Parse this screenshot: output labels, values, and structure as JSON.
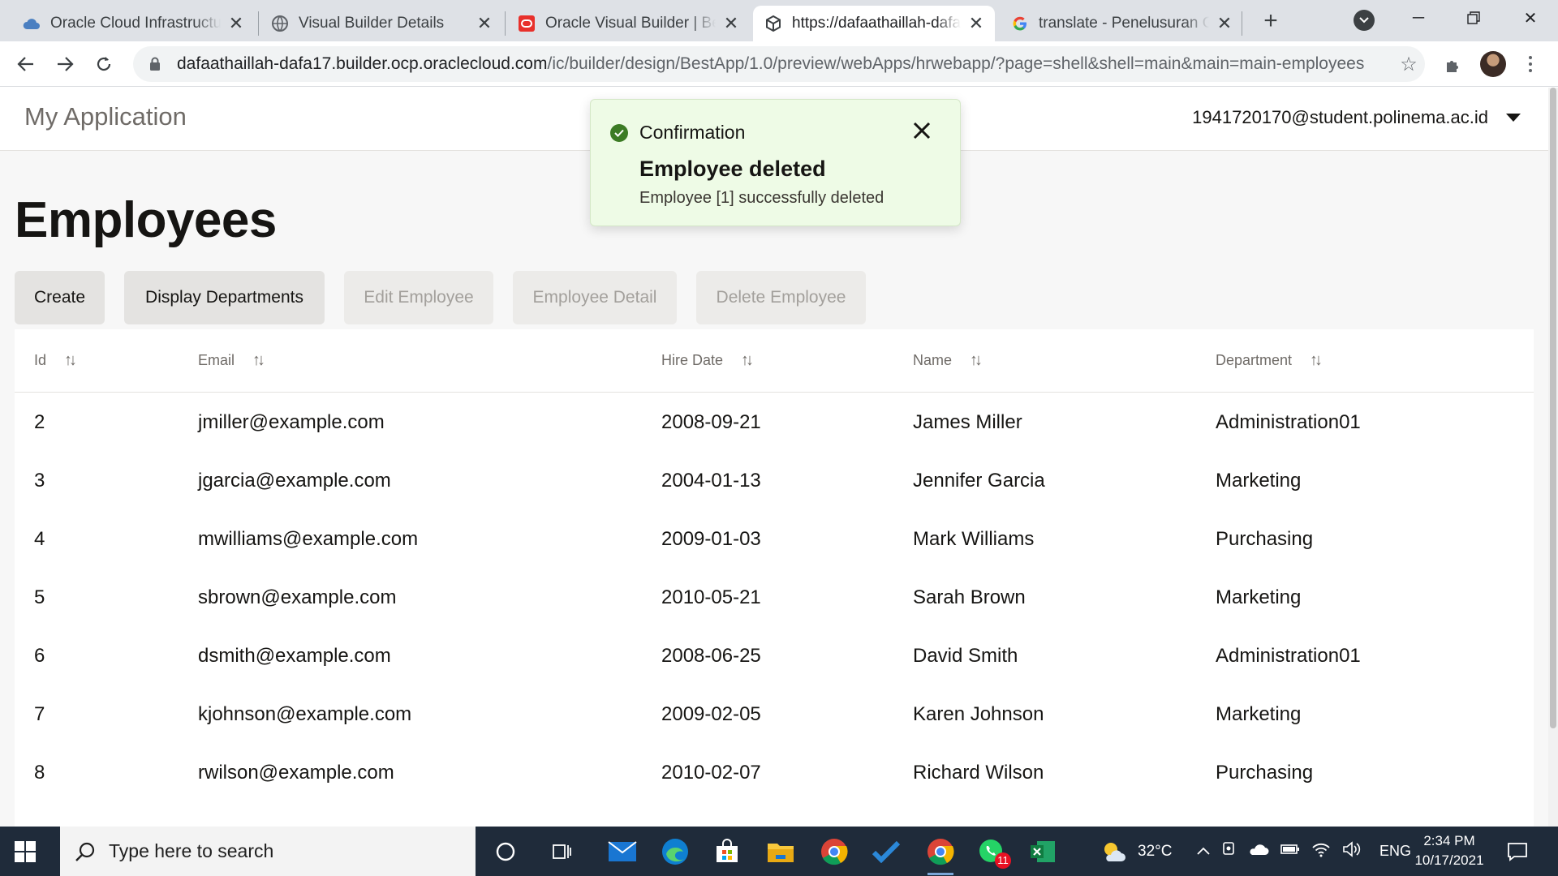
{
  "browser": {
    "tabs": [
      {
        "label": "Oracle Cloud Infrastructure",
        "icon": "cloud-icon"
      },
      {
        "label": "Visual Builder Details",
        "icon": "globe-icon"
      },
      {
        "label": "Oracle Visual Builder | Best",
        "icon": "oracle-icon"
      },
      {
        "label": "https://dafaathaillah-dafa17",
        "icon": "cube-icon"
      },
      {
        "label": "translate - Penelusuran Google",
        "icon": "google-icon"
      }
    ],
    "active_tab_index": 3,
    "url_host": "dafaathaillah-dafa17.builder.ocp.oraclecloud.com",
    "url_path": "/ic/builder/design/BestApp/1.0/preview/webApps/hrwebapp/?page=shell&shell=main&main=main-employees"
  },
  "app": {
    "title": "My Application",
    "user": "1941720170@student.polinema.ac.id",
    "page_title": "Employees",
    "buttons": [
      {
        "label": "Create",
        "enabled": true
      },
      {
        "label": "Display Departments",
        "enabled": true
      },
      {
        "label": "Edit Employee",
        "enabled": false
      },
      {
        "label": "Employee Detail",
        "enabled": false
      },
      {
        "label": "Delete Employee",
        "enabled": false
      }
    ],
    "table": {
      "columns": [
        "Id",
        "Email",
        "Hire Date",
        "Name",
        "Department"
      ],
      "rows": [
        [
          "2",
          "jmiller@example.com",
          "2008-09-21",
          "James Miller",
          "Administration01"
        ],
        [
          "3",
          "jgarcia@example.com",
          "2004-01-13",
          "Jennifer Garcia",
          "Marketing"
        ],
        [
          "4",
          "mwilliams@example.com",
          "2009-01-03",
          "Mark Williams",
          "Purchasing"
        ],
        [
          "5",
          "sbrown@example.com",
          "2010-05-21",
          "Sarah Brown",
          "Marketing"
        ],
        [
          "6",
          "dsmith@example.com",
          "2008-06-25",
          "David Smith",
          "Administration01"
        ],
        [
          "7",
          "kjohnson@example.com",
          "2009-02-05",
          "Karen Johnson",
          "Marketing"
        ],
        [
          "8",
          "rwilson@example.com",
          "2010-02-07",
          "Richard Wilson",
          "Purchasing"
        ]
      ]
    },
    "toast": {
      "title": "Confirmation",
      "heading": "Employee deleted",
      "message": "Employee [1] successfully deleted"
    }
  },
  "taskbar": {
    "search_placeholder": "Type here to search",
    "temperature": "32°C",
    "language": "ENG",
    "time": "2:34 PM",
    "date": "10/17/2021",
    "whatsapp_badge": "11"
  },
  "colors": {
    "toast_bg": "#eefbe6",
    "success": "#3c7b25",
    "taskbar": "#1f2b3a"
  }
}
